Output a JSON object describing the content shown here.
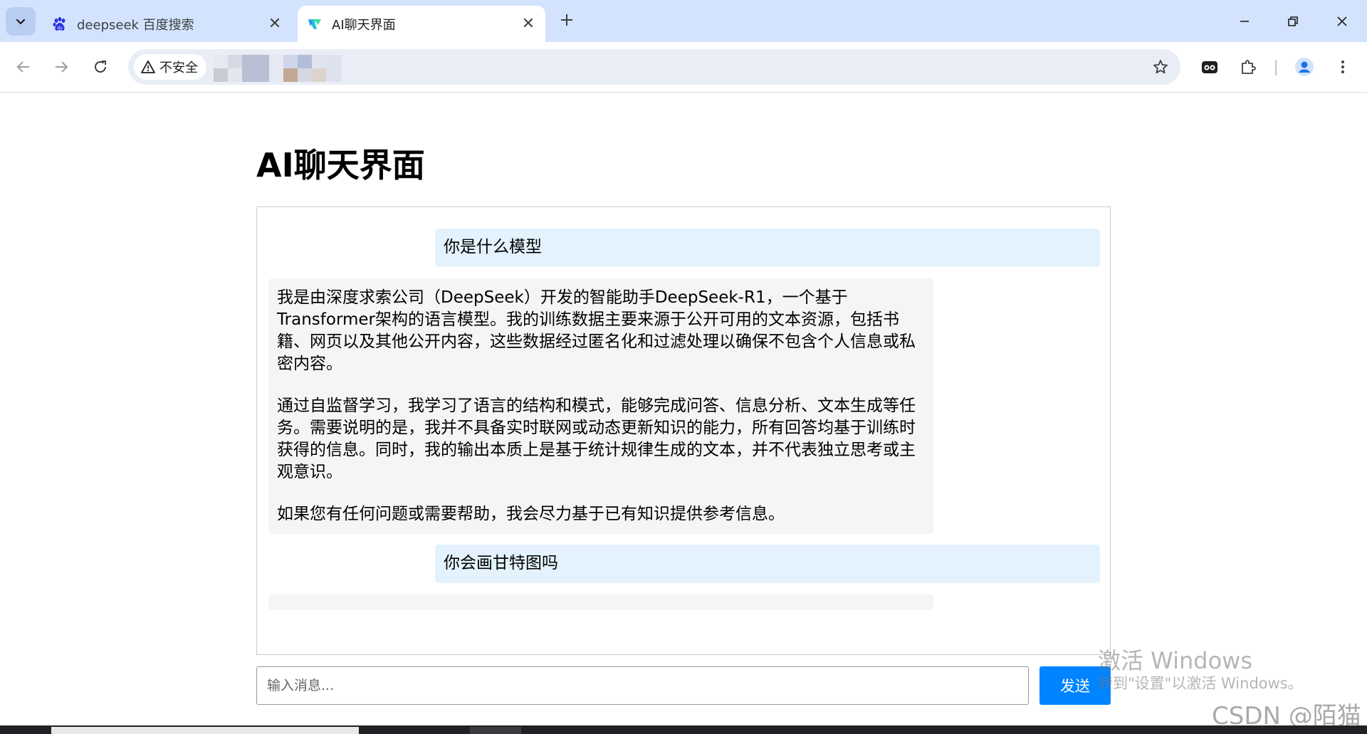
{
  "browser": {
    "tabs": [
      {
        "title": "deepseek 百度搜索",
        "favicon": "baidu-paw-icon",
        "active": false
      },
      {
        "title": "AI聊天界面",
        "favicon": "app-logo-icon",
        "active": true
      }
    ],
    "security_label": "不安全",
    "colors": {
      "tabstrip": "#d3e3fd",
      "omnibox": "#e9eef6",
      "profile": "#1a73e8"
    }
  },
  "page": {
    "title": "AI聊天界面"
  },
  "chat": {
    "messages": [
      {
        "role": "user",
        "text": "你是什么模型"
      },
      {
        "role": "assistant",
        "paragraphs": [
          "我是由深度求索公司（DeepSeek）开发的智能助手DeepSeek-R1，一个基于Transformer架构的语言模型。我的训练数据主要来源于公开可用的文本资源，包括书籍、网页以及其他公开内容，这些数据经过匿名化和过滤处理以确保不包含个人信息或私密内容。",
          "通过自监督学习，我学习了语言的结构和模式，能够完成问答、信息分析、文本生成等任务。需要说明的是，我并不具备实时联网或动态更新知识的能力，所有回答均基于训练时获得的信息。同时，我的输出本质上是基于统计规律生成的文本，并不代表独立思考或主观意识。",
          "如果您有任何问题或需要帮助，我会尽力基于已有知识提供参考信息。"
        ]
      },
      {
        "role": "user",
        "text": "你会画甘特图吗"
      },
      {
        "role": "assistant",
        "paragraphs": []
      }
    ],
    "colors": {
      "user_bubble": "#e3f2fd",
      "bot_bubble": "#f5f5f5",
      "send_button": "#0084ff"
    }
  },
  "composer": {
    "placeholder": "输入消息...",
    "value": "",
    "send_label": "发送"
  },
  "overlay": {
    "activation_title": "激活 Windows",
    "activation_sub": "转到\"设置\"以激活 Windows。",
    "csdn": "CSDN @陌猫"
  }
}
